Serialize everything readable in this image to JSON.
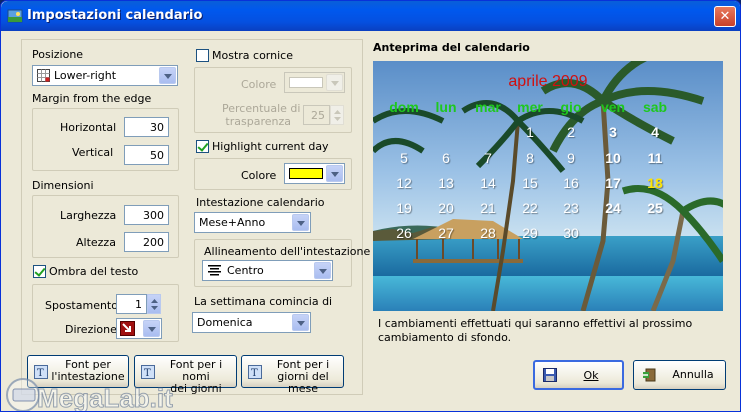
{
  "window": {
    "title": "Impostazioni calendario",
    "close_glyph": "✕"
  },
  "left": {
    "position_label": "Posizione",
    "position_value": "Lower-right",
    "margin_label": "Margin from the edge",
    "horizontal_label": "Horizontal",
    "horizontal_value": "30",
    "vertical_label": "Vertical",
    "vertical_value": "50",
    "dimensions_label": "Dimensioni",
    "width_label": "Larghezza",
    "width_value": "300",
    "height_label": "Altezza",
    "height_value": "200",
    "shadow_label": "Ombra del testo",
    "shift_label": "Spostamento",
    "shift_value": "1",
    "direction_label": "Direzione"
  },
  "middle": {
    "frame_label": "Mostra cornice",
    "frame_color_label": "Colore",
    "transparency_label_1": "Percentuale di",
    "transparency_label_2": "trasparenza",
    "transparency_value": "25",
    "highlight_label": "Highlight current day",
    "highlight_color_label": "Colore",
    "highlight_color": "#ffff00",
    "header_label": "Intestazione calendario",
    "header_value": "Mese+Anno",
    "alignment_label": "Allineamento dell'intestazione",
    "alignment_value": "Centro",
    "week_start_label": "La settimana comincia di",
    "week_start_value": "Domenica"
  },
  "font_buttons": {
    "header_1": "Font per",
    "header_2": "l'intestazione",
    "daynames_1": "Font per i nomi",
    "daynames_2": "dei giorni",
    "days_1": "Font per i",
    "days_2": "giorni del mese"
  },
  "preview": {
    "title": "Anteprima del calendario",
    "month": "aprile 2009",
    "day_names": [
      "dom",
      "lun",
      "mar",
      "mer",
      "gio",
      "ven",
      "sab"
    ],
    "weeks": [
      [
        "",
        "",
        "",
        "1",
        "2",
        "3",
        "4"
      ],
      [
        "5",
        "6",
        "7",
        "8",
        "9",
        "10",
        "11"
      ],
      [
        "12",
        "13",
        "14",
        "15",
        "16",
        "17",
        "18"
      ],
      [
        "19",
        "20",
        "21",
        "22",
        "23",
        "24",
        "25"
      ],
      [
        "26",
        "27",
        "28",
        "29",
        "30",
        "",
        ""
      ]
    ],
    "today": "18",
    "note_1": "I cambiamenti effettuati qui saranno effettivi al prossimo",
    "note_2": "cambiamento di sfondo."
  },
  "actions": {
    "ok_label": "Ok",
    "cancel_label": "Annulla"
  },
  "watermark": {
    "text": "MegaLab.it"
  },
  "colors": {
    "title_bar": "#0058ee",
    "month_title": "#d01010",
    "day_names": "#1ec81e",
    "today": "#ffe400"
  }
}
